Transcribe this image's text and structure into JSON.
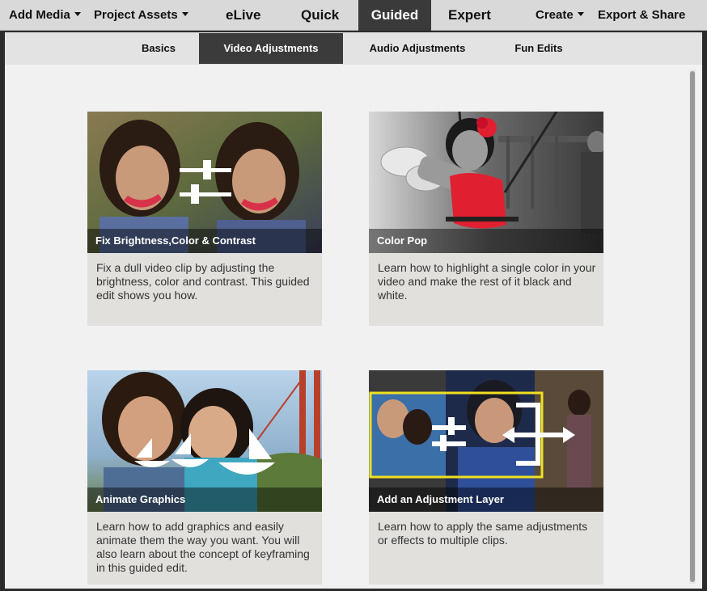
{
  "topbar": {
    "add_media": "Add Media",
    "project_assets": "Project Assets",
    "modes": [
      "eLive",
      "Quick",
      "Guided",
      "Expert"
    ],
    "active_mode": "Guided",
    "create": "Create",
    "export_share": "Export & Share"
  },
  "subtabs": [
    "Basics",
    "Video Adjustments",
    "Audio Adjustments",
    "Fun Edits"
  ],
  "active_subtab": "Video Adjustments",
  "cards": [
    {
      "title": "Fix Brightness,Color & Contrast",
      "description": "Fix a dull video clip by adjusting the brightness, color and contrast. This guided edit shows you how.",
      "icon": "sliders-icon"
    },
    {
      "title": "Color Pop",
      "description": "Learn how to highlight a single color in your video and make the rest of it black and white.",
      "icon": "color-pop-photo"
    },
    {
      "title": "Animate Graphics",
      "description": "Learn how to add graphics and easily animate them the way you want. You will also learn about the concept of keyframing in this guided edit.",
      "icon": "sailboats-icon"
    },
    {
      "title": "Add an Adjustment Layer",
      "description": "Learn how to apply the same adjustments or effects to multiple clips.",
      "icon": "adjustment-layer-icon"
    }
  ],
  "colors": {
    "topbar_bg": "#d9d9d9",
    "active_tab_bg": "#3a3a3a",
    "content_bg": "#f1f1f1",
    "card_bg": "#e1e0dd",
    "accent_red": "#e02030",
    "adjustment_frame": "#f0e020"
  }
}
